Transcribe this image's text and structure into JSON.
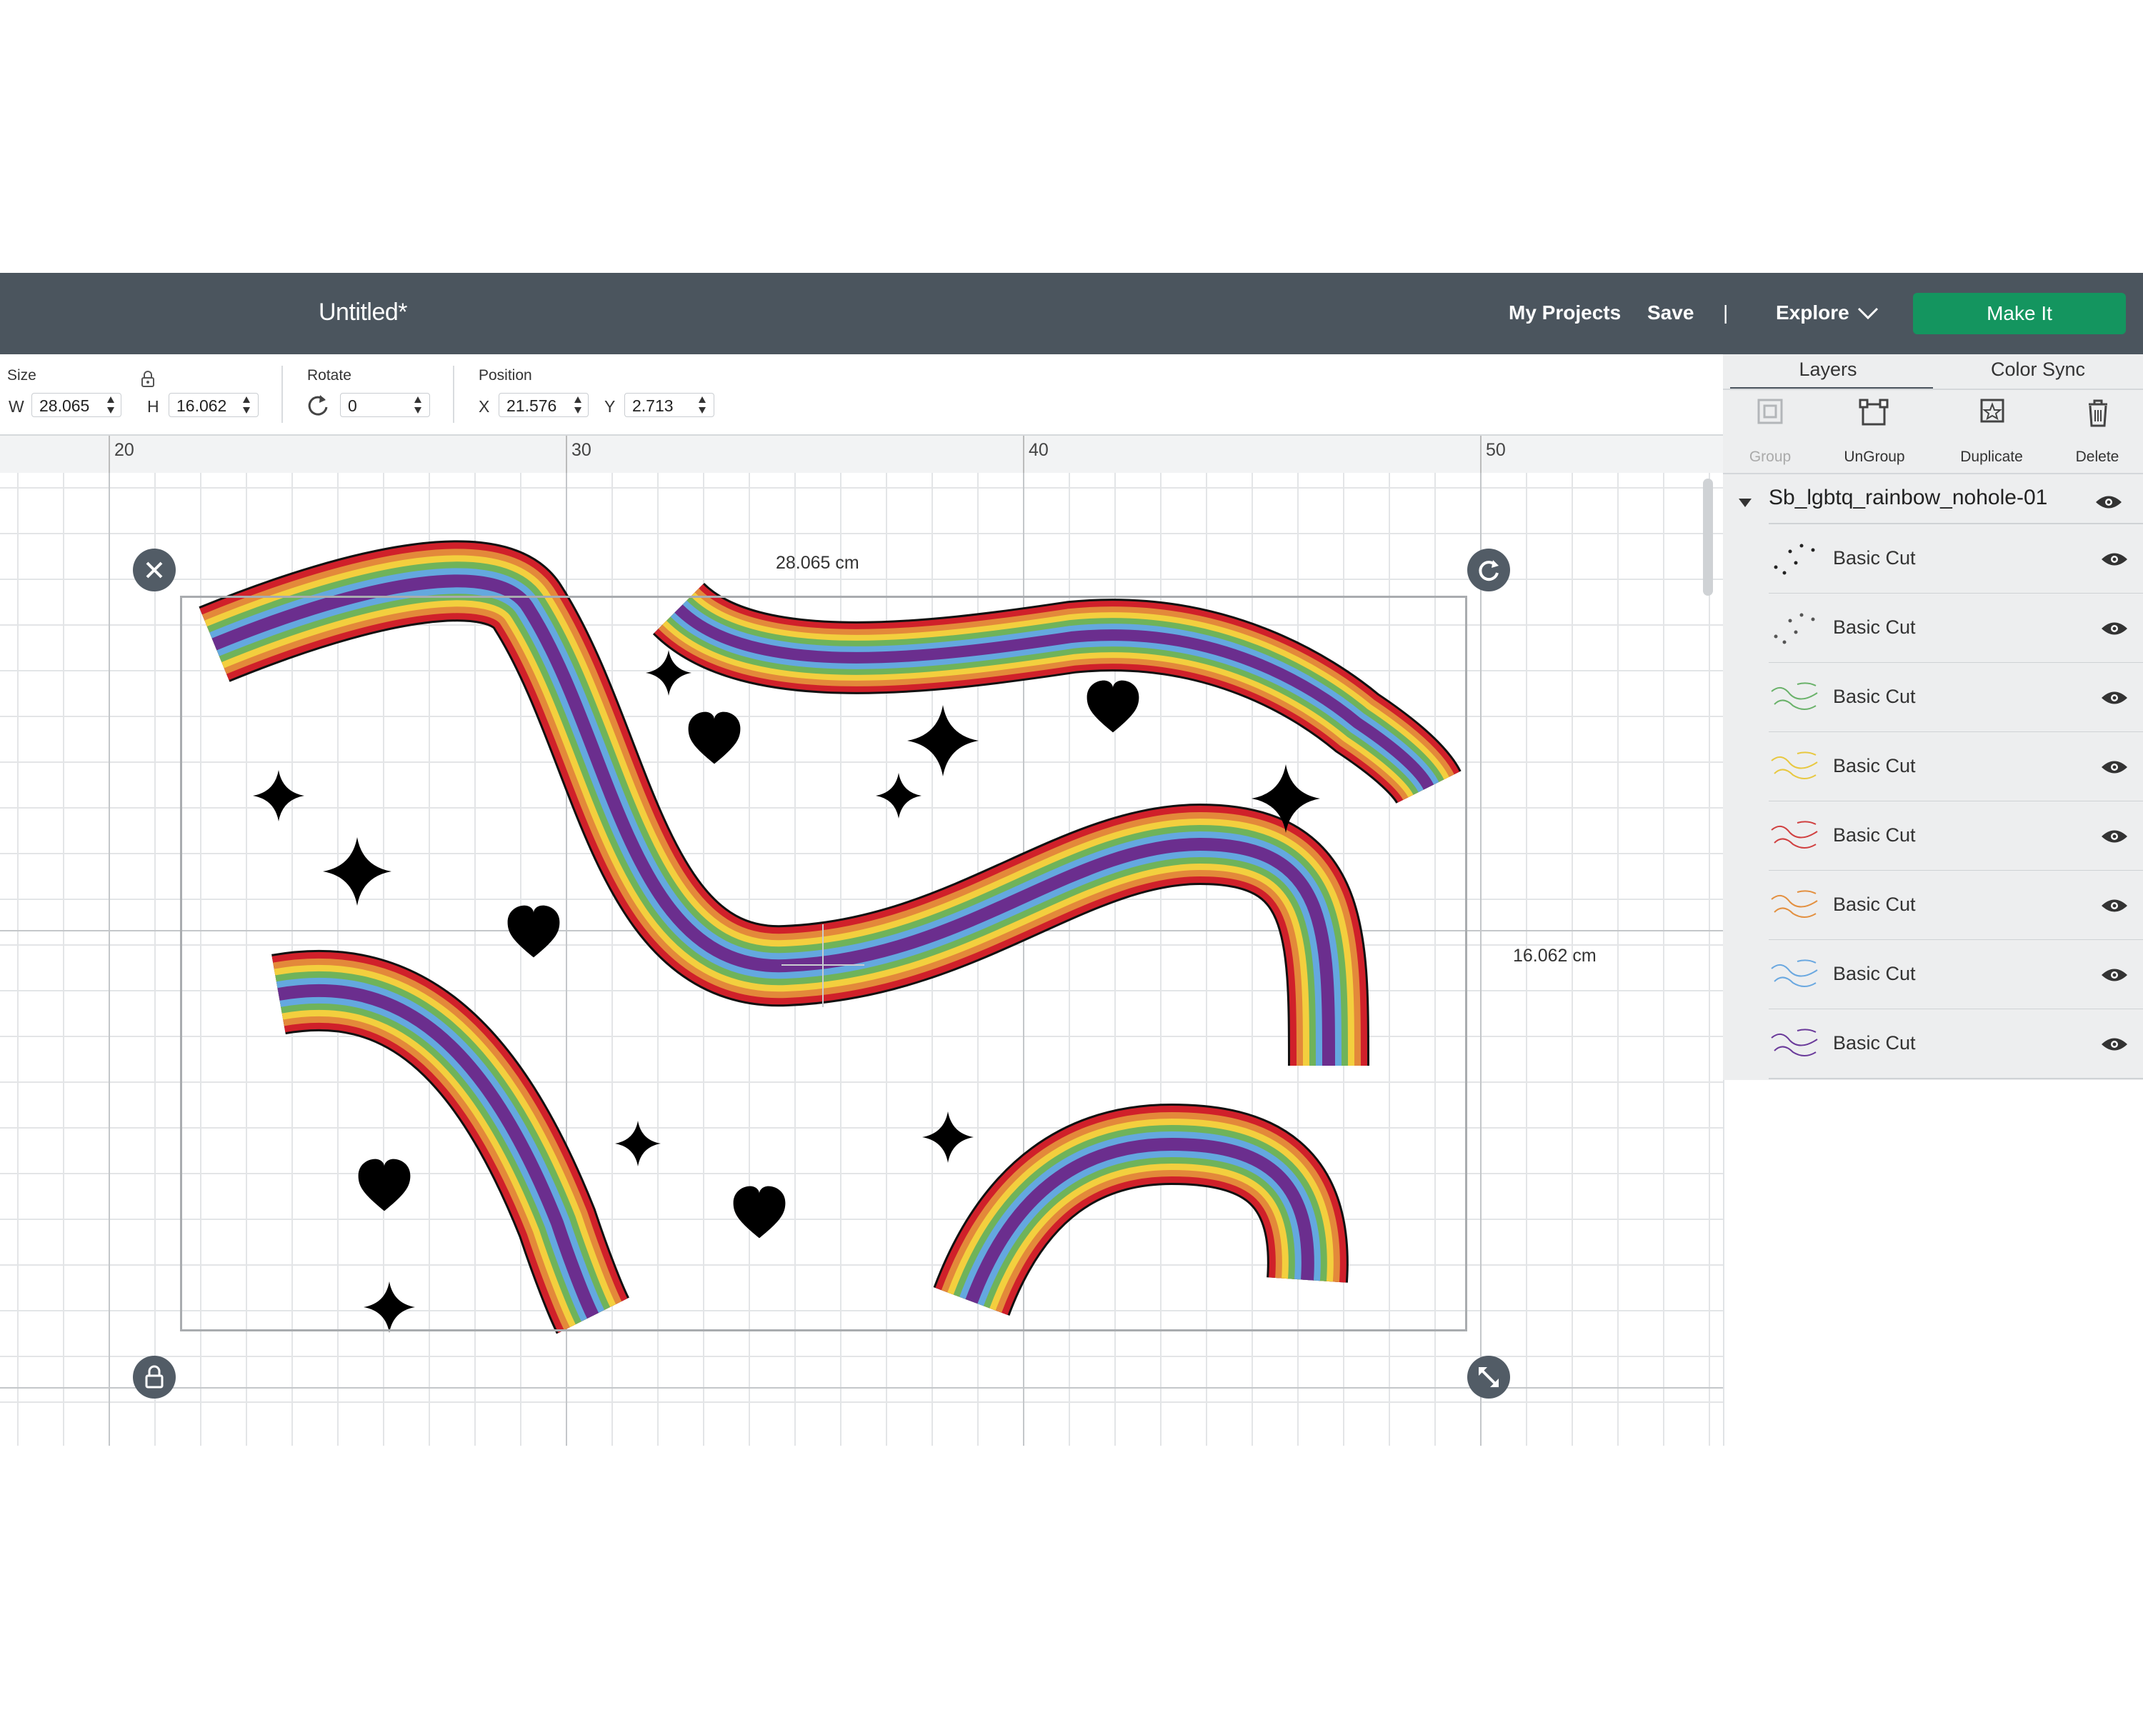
{
  "header": {
    "title": "Untitled*",
    "my_projects": "My Projects",
    "save": "Save",
    "divider": "|",
    "explore": "Explore",
    "make_it": "Make It"
  },
  "toolbar": {
    "size_label": "Size",
    "w_label": "W",
    "w_value": "28.065",
    "h_label": "H",
    "h_value": "16.062",
    "rotate_label": "Rotate",
    "rotate_value": "0",
    "position_label": "Position",
    "x_label": "X",
    "x_value": "21.576",
    "y_label": "Y",
    "y_value": "2.713"
  },
  "ruler": {
    "marks": [
      "20",
      "30",
      "40",
      "50"
    ]
  },
  "canvas": {
    "width_label": "28.065 cm",
    "height_label": "16.062 cm"
  },
  "panel": {
    "tabs": [
      "Layers",
      "Color Sync"
    ],
    "tools": [
      "Group",
      "UnGroup",
      "Duplicate",
      "Delete"
    ],
    "group_name": "Sb_lgbtq_rainbow_nohole-01",
    "layers": [
      {
        "label": "Basic Cut",
        "color": "#222222"
      },
      {
        "label": "Basic Cut",
        "color": "#555555"
      },
      {
        "label": "Basic Cut",
        "color": "#6ab26a"
      },
      {
        "label": "Basic Cut",
        "color": "#e8c840"
      },
      {
        "label": "Basic Cut",
        "color": "#d04040"
      },
      {
        "label": "Basic Cut",
        "color": "#e39040"
      },
      {
        "label": "Basic Cut",
        "color": "#6aa8e0"
      },
      {
        "label": "Basic Cut",
        "color": "#6a3a9a"
      }
    ]
  },
  "colors": {
    "header_bg": "#4b555e",
    "accent": "#14955f",
    "rainbow": [
      "#d0202a",
      "#e3893a",
      "#f3cf3e",
      "#6fb35a",
      "#64a8df",
      "#6b2e8e"
    ]
  }
}
